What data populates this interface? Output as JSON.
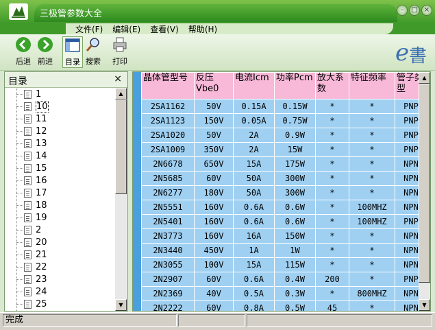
{
  "window": {
    "title": "三极管参数大全"
  },
  "menu": [
    "文件(F)",
    "编辑(E)",
    "查看(V)",
    "帮助(H)"
  ],
  "toolbar": [
    {
      "label": "后退",
      "icon": "back-arrow-icon"
    },
    {
      "label": "前进",
      "icon": "forward-arrow-icon"
    },
    {
      "label": "目录",
      "icon": "contents-icon"
    },
    {
      "label": "搜索",
      "icon": "search-icon"
    },
    {
      "label": "打印",
      "icon": "printer-icon"
    }
  ],
  "logo": "e書",
  "sidebar": {
    "title": "目录",
    "close": "×",
    "items": [
      "1",
      "10",
      "11",
      "12",
      "13",
      "14",
      "15",
      "16",
      "17",
      "18",
      "19",
      "2",
      "20",
      "21",
      "22",
      "23",
      "24",
      "25"
    ],
    "selected": "10"
  },
  "table": {
    "headers": [
      "晶体管型号",
      "反压Vbe0",
      "电流Icm",
      "功率Pcm",
      "放大系数",
      "特征频率",
      "管子类型"
    ],
    "rows": [
      [
        "2SA1162",
        "50V",
        "0.15A",
        "0.15W",
        "*",
        "*",
        "PNP"
      ],
      [
        "2SA1123",
        "150V",
        "0.05A",
        "0.75W",
        "*",
        "*",
        "PNP"
      ],
      [
        "2SA1020",
        "50V",
        "2A",
        "0.9W",
        "*",
        "*",
        "PNP"
      ],
      [
        "2SA1009",
        "350V",
        "2A",
        "15W",
        "*",
        "*",
        "PNP"
      ],
      [
        "2N6678",
        "650V",
        "15A",
        "175W",
        "*",
        "*",
        "NPN"
      ],
      [
        "2N5685",
        "60V",
        "50A",
        "300W",
        "*",
        "*",
        "NPN"
      ],
      [
        "2N6277",
        "180V",
        "50A",
        "300W",
        "*",
        "*",
        "NPN"
      ],
      [
        "2N5551",
        "160V",
        "0.6A",
        "0.6W",
        "*",
        "100MHZ",
        "NPN"
      ],
      [
        "2N5401",
        "160V",
        "0.6A",
        "0.6W",
        "*",
        "100MHZ",
        "PNP"
      ],
      [
        "2N3773",
        "160V",
        "16A",
        "150W",
        "*",
        "*",
        "NPN"
      ],
      [
        "2N3440",
        "450V",
        "1A",
        "1W",
        "*",
        "*",
        "NPN"
      ],
      [
        "2N3055",
        "100V",
        "15A",
        "115W",
        "*",
        "*",
        "NPN"
      ],
      [
        "2N2907",
        "60V",
        "0.6A",
        "0.4W",
        "200",
        "*",
        "PNP"
      ],
      [
        "2N2369",
        "40V",
        "0.5A",
        "0.3W",
        "*",
        "800MHZ",
        "NPN"
      ],
      [
        "2N2222",
        "60V",
        "0.8A",
        "0.5W",
        "45",
        "*",
        "NPN"
      ]
    ]
  },
  "status": {
    "text": "完成"
  }
}
